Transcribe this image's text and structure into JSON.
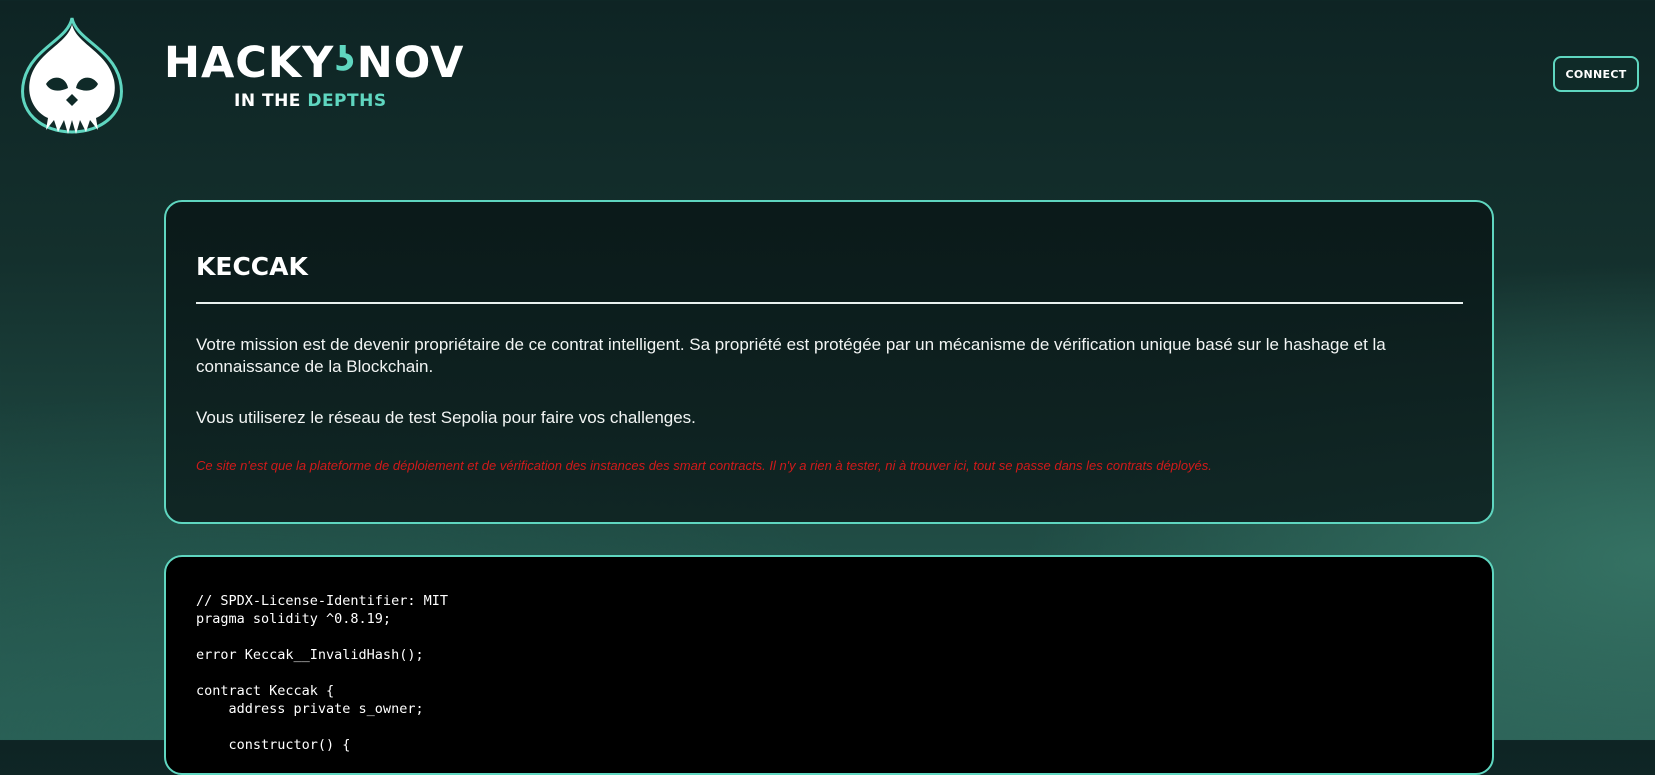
{
  "header": {
    "brand_title_left": "HACKY",
    "brand_title_hook": "ʖ",
    "brand_title_right": "NOV",
    "brand_sub_prefix": "IN THE ",
    "brand_sub_accent": "DEPTHS",
    "connect_label": "CONNECT",
    "logo_icon": "kraken-drop-icon",
    "accent_color": "#5fd6c0"
  },
  "challenge": {
    "title": "KECCAK",
    "description_1": "Votre mission est de devenir propriétaire de ce contrat intelligent. Sa propriété est protégée par un mécanisme de vérification unique basé sur le hashage et la connaissance de la Blockchain.",
    "description_2": "Vous utiliserez le réseau de test Sepolia pour faire vos challenges.",
    "warning": "Ce site n'est que la plateforme de déploiement et de vérification des instances des smart contracts. Il n'y a rien à tester, ni à trouver ici, tout se passe dans les contrats déployés.",
    "warning_color": "#d11a1a"
  },
  "code": {
    "lines": [
      "// SPDX-License-Identifier: MIT",
      "pragma solidity ^0.8.19;",
      "",
      "error Keccak__InvalidHash();",
      "",
      "contract Keccak {",
      "    address private s_owner;",
      "",
      "    constructor() {"
    ]
  }
}
